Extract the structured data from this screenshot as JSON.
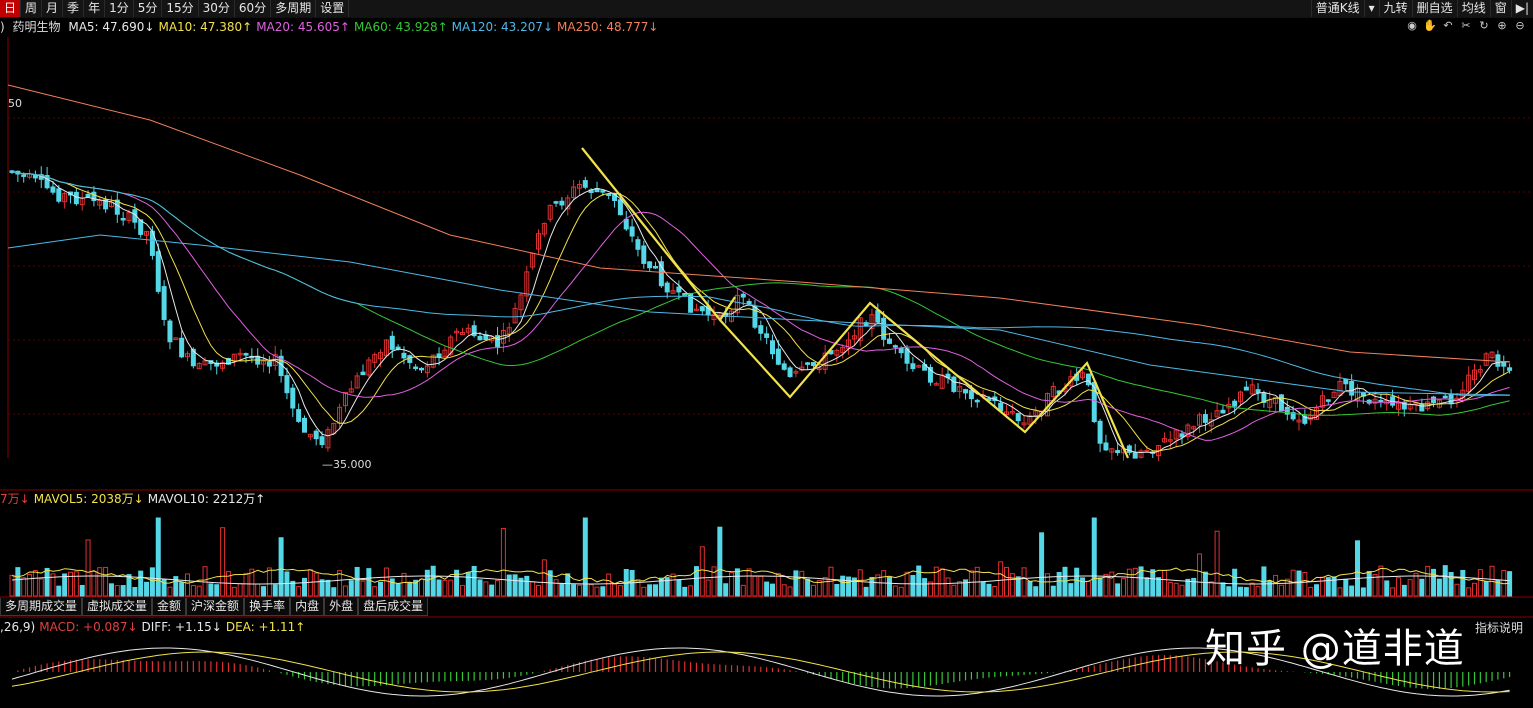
{
  "toolbar": {
    "tabs": [
      "日",
      "周",
      "月",
      "季",
      "年",
      "1分",
      "5分",
      "15分",
      "30分",
      "60分",
      "多周期",
      "设置"
    ],
    "active_tab": "日",
    "right_items": [
      "普通K线",
      "▾",
      "九转",
      "删自选",
      "均线",
      "窗",
      "▶|"
    ]
  },
  "ma_legend": {
    "prefix": ")",
    "stock_name": "药明生物",
    "items": [
      {
        "label": "MA5: 47.690↓",
        "color": "#e8e8e8"
      },
      {
        "label": "MA10: 47.380↑",
        "color": "#f2e24a"
      },
      {
        "label": "MA20: 45.605↑",
        "color": "#e060e0"
      },
      {
        "label": "MA60: 43.928↑",
        "color": "#35c735"
      },
      {
        "label": "MA120: 43.207↓",
        "color": "#4fb8e6"
      },
      {
        "label": "MA250: 48.777↓",
        "color": "#f0805a"
      }
    ]
  },
  "chart_tools": [
    "eye-icon",
    "hand-icon",
    "undo-icon",
    "scissors-icon",
    "refresh-icon",
    "zoom-in-icon",
    "zoom-out-icon"
  ],
  "price_labels": {
    "level_50": "50",
    "low": "35.000"
  },
  "volume_legend": [
    {
      "label": "7万↓",
      "color": "#e24040"
    },
    {
      "label": "MAVOL5: 2038万↓",
      "color": "#f2e24a"
    },
    {
      "label": "MAVOL10: 2212万↑",
      "color": "#e8e8e8"
    }
  ],
  "indicator_tabs": [
    "多周期成交量",
    "虚拟成交量",
    "金额",
    "沪深金额",
    "换手率",
    "内盘",
    "外盘",
    "盘后成交量"
  ],
  "macd_legend": [
    {
      "label": ",26,9)",
      "color": "#e8e8e8"
    },
    {
      "label": "MACD: +0.087↓",
      "color": "#e24040"
    },
    {
      "label": "DIFF: +1.15↓",
      "color": "#e8e8e8"
    },
    {
      "label": "DEA: +1.11↑",
      "color": "#f2e24a"
    }
  ],
  "indicator_help": "指标说明",
  "watermark": "知乎 @道非道",
  "colors": {
    "up": "#e03030",
    "down": "#54d8e8",
    "zigzag": "#f2e24a",
    "grid": "#5a0000"
  },
  "chart_data": {
    "type": "line",
    "title": "药明生物",
    "ylim": [
      33,
      55
    ],
    "moving_averages": [
      {
        "name": "MA5",
        "last": 47.69
      },
      {
        "name": "MA10",
        "last": 47.38
      },
      {
        "name": "MA20",
        "last": 45.605
      },
      {
        "name": "MA60",
        "last": 43.928
      },
      {
        "name": "MA120",
        "last": 43.207
      },
      {
        "name": "MA250",
        "last": 48.777
      }
    ],
    "low_marker": 35.0,
    "mavol": {
      "MAVOL5": "2038万",
      "MAVOL10": "2212万"
    },
    "macd": {
      "MACD": 0.087,
      "DIFF": 1.15,
      "DEA": 1.11
    }
  }
}
